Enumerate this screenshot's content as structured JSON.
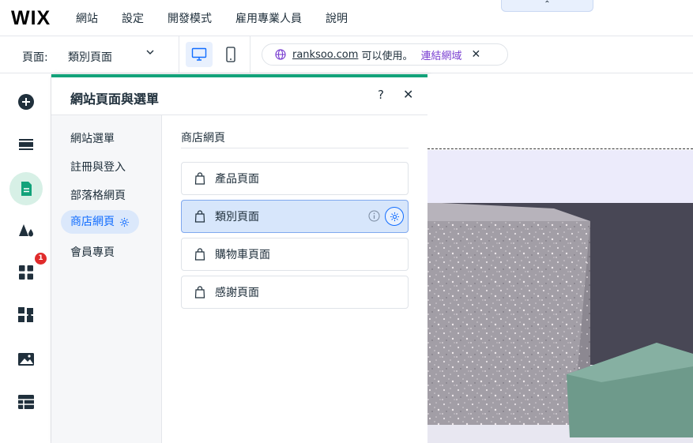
{
  "topbar": {
    "logo": "WIX",
    "menu": [
      "網站",
      "設定",
      "開發模式",
      "雇用專業人員",
      "說明"
    ],
    "collapse_glyph": "⌃"
  },
  "toolbar": {
    "page_label": "頁面:",
    "page_value": "類別頁面",
    "domain_link": "ranksoo.com",
    "domain_status": "可以使用。",
    "domain_connect": "連結網域"
  },
  "leftrail": {
    "icons": [
      "add-icon",
      "sections-icon",
      "pages-icon",
      "design-icon",
      "apps-icon",
      "business-icon",
      "media-icon",
      "cms-icon"
    ],
    "apps_badge": "1",
    "accent_color": "#12a27a"
  },
  "panel": {
    "title": "網站頁面與選單",
    "help": "?",
    "close": "✕",
    "nav": [
      {
        "label": "網站選單"
      },
      {
        "label": "註冊與登入"
      },
      {
        "label": "部落格網頁"
      },
      {
        "label": "商店網頁",
        "active": true
      },
      {
        "label": "會員專頁"
      }
    ],
    "section_title": "商店網頁",
    "pages": [
      {
        "label": "產品頁面"
      },
      {
        "label": "類別頁面",
        "selected": true
      },
      {
        "label": "購物車頁面"
      },
      {
        "label": "感謝頁面"
      }
    ]
  },
  "colors": {
    "brand_blue": "#116dff",
    "selected_bg": "#d7e6fb",
    "canvas_bg": "#ecebfb"
  }
}
